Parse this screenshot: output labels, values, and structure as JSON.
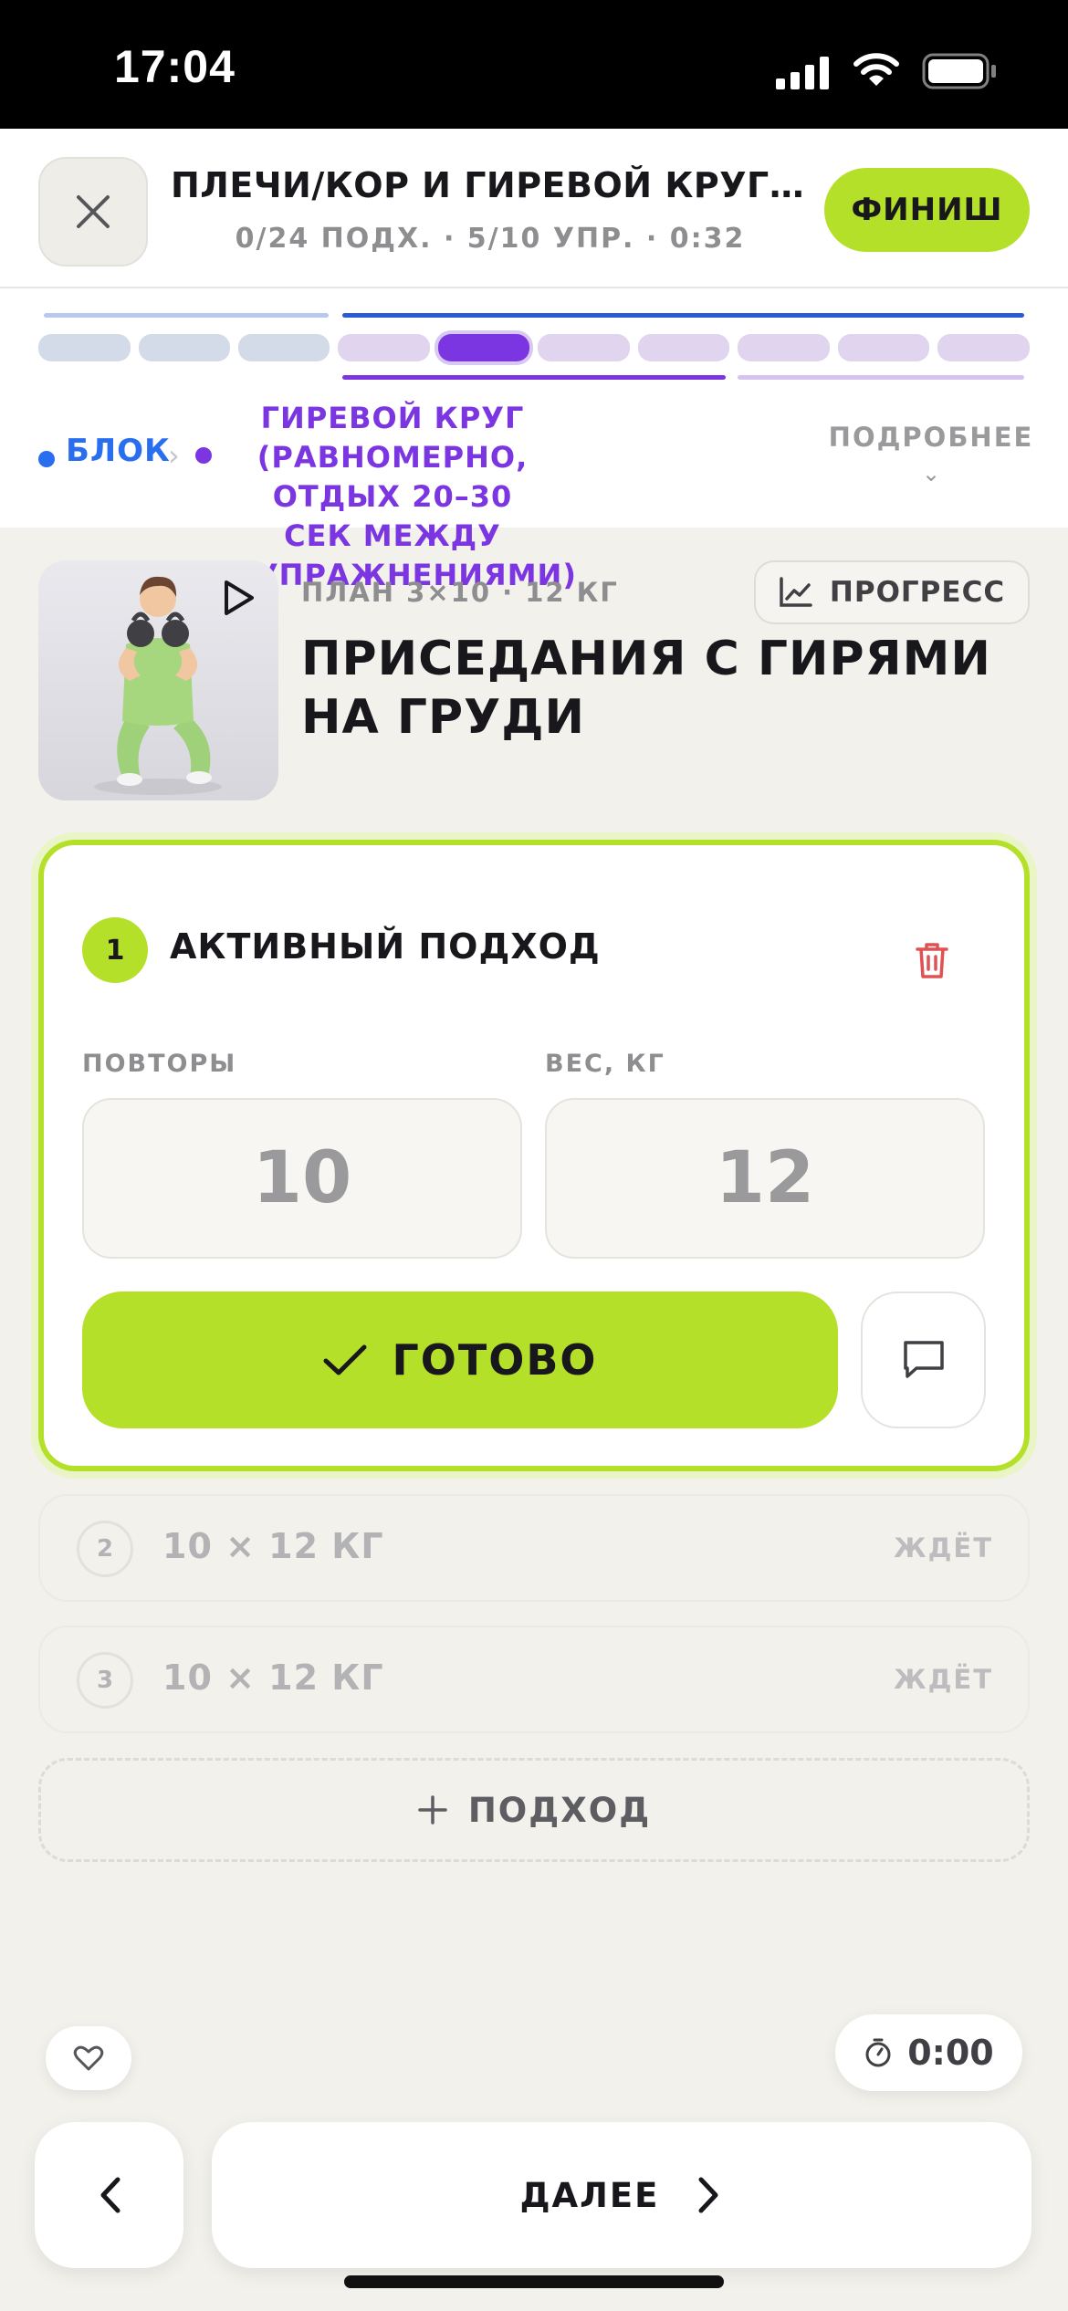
{
  "status_bar": {
    "time": "17:04"
  },
  "header": {
    "title": "ПЛЕЧИ/КОР И ГИРЕВОЙ КРУГ — ФИНИШ",
    "subtitle": "0/24 ПОДХ. · 5/10 УПР. · 0:32",
    "finish_label": "ФИНИШ"
  },
  "progress": {
    "segments_total": 10,
    "current_index": 4
  },
  "breadcrumb": {
    "block_label": "БЛОК",
    "current_label": "ГИРЕВОЙ КРУГ (РАВНОМЕРНО, ОТДЫХ 20–30 СЕК МЕЖДУ УПРАЖНЕНИЯМИ)",
    "more_label": "ПОДРОБНЕЕ"
  },
  "exercise": {
    "plan": "ПЛАН 3×10 · 12 КГ",
    "progress_label": "ПРОГРЕСС",
    "title": "ПРИСЕДАНИЯ С ГИРЯМИ НА ГРУДИ"
  },
  "active_set": {
    "number": "1",
    "title": "АКТИВНЫЙ ПОДХОД",
    "reps_label": "ПОВТОРЫ",
    "reps_value": "10",
    "weight_label": "ВЕС, КГ",
    "weight_value": "12",
    "done_label": "ГОТОВО"
  },
  "pending_sets": [
    {
      "number": "2",
      "text": "10 × 12 КГ",
      "status": "ЖДЁТ"
    },
    {
      "number": "3",
      "text": "10 × 12 КГ",
      "status": "ЖДЁТ"
    }
  ],
  "add_set_label": "ПОДХОД",
  "timer": "0:00",
  "next_label": "ДАЛЕЕ",
  "colors": {
    "accent_green": "#b5e02a",
    "accent_purple": "#7b36e2",
    "accent_blue": "#2a6ef0",
    "danger": "#e05252"
  }
}
